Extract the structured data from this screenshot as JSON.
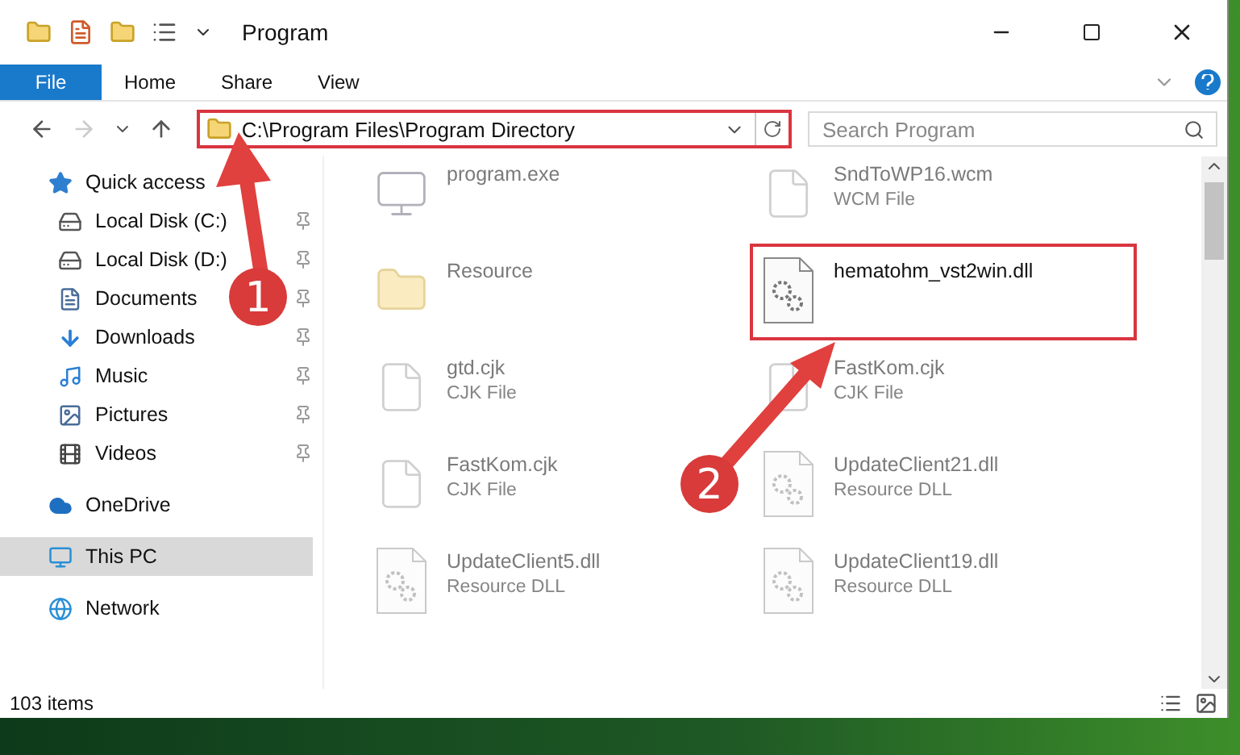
{
  "window": {
    "title": "Program"
  },
  "ribbon": {
    "tabs": [
      {
        "label": "File",
        "kind": "file"
      },
      {
        "label": "Home",
        "kind": "tab"
      },
      {
        "label": "Share",
        "kind": "tab"
      },
      {
        "label": "View",
        "kind": "tab"
      }
    ]
  },
  "address_bar": {
    "path": "C:\\Program Files\\Program Directory",
    "highlighted": true
  },
  "search": {
    "placeholder": "Search Program"
  },
  "sidebar": {
    "items": [
      {
        "label": "Quick access",
        "kind": "group",
        "pinned": false,
        "selected": false
      },
      {
        "label": "Local Disk (C:)",
        "kind": "child",
        "pinned": true,
        "selected": false
      },
      {
        "label": "Local Disk (D:)",
        "kind": "child",
        "pinned": true,
        "selected": false
      },
      {
        "label": "Documents",
        "kind": "child",
        "pinned": true,
        "selected": false
      },
      {
        "label": "Downloads",
        "kind": "child",
        "pinned": true,
        "selected": false
      },
      {
        "label": "Music",
        "kind": "child",
        "pinned": true,
        "selected": false
      },
      {
        "label": "Pictures",
        "kind": "child",
        "pinned": true,
        "selected": false
      },
      {
        "label": "Videos",
        "kind": "child",
        "pinned": true,
        "selected": false
      },
      {
        "label": "OneDrive",
        "kind": "group",
        "pinned": false,
        "selected": false
      },
      {
        "label": "This PC",
        "kind": "group",
        "pinned": false,
        "selected": true
      },
      {
        "label": "Network",
        "kind": "group",
        "pinned": false,
        "selected": false
      }
    ]
  },
  "files": [
    {
      "name": "program.exe",
      "kind": "exe",
      "highlighted": false
    },
    {
      "name": "SndToWP16.wcm",
      "type": "WCM File",
      "kind": "file",
      "highlighted": false
    },
    {
      "name": "Resource",
      "kind": "folder",
      "highlighted": false
    },
    {
      "name": "hematohm_vst2win.dll",
      "kind": "dll",
      "highlighted": true
    },
    {
      "name": "gtd.cjk",
      "type": "CJK File",
      "kind": "file",
      "highlighted": false
    },
    {
      "name": "FastKom.cjk",
      "type": "CJK File",
      "kind": "file",
      "highlighted": false
    },
    {
      "name": "FastKom.cjk",
      "type": "CJK File",
      "kind": "file",
      "highlighted": false
    },
    {
      "name": "UpdateClient21.dll",
      "type": "Resource DLL",
      "kind": "dll",
      "highlighted": false
    },
    {
      "name": "UpdateClient5.dll",
      "type": "Resource DLL",
      "kind": "dll",
      "highlighted": false
    },
    {
      "name": "UpdateClient19.dll",
      "type": "Resource DLL",
      "kind": "dll",
      "highlighted": false
    }
  ],
  "status_bar": {
    "count": "103 items"
  },
  "annotations": [
    {
      "label": "1"
    },
    {
      "label": "2"
    }
  ]
}
